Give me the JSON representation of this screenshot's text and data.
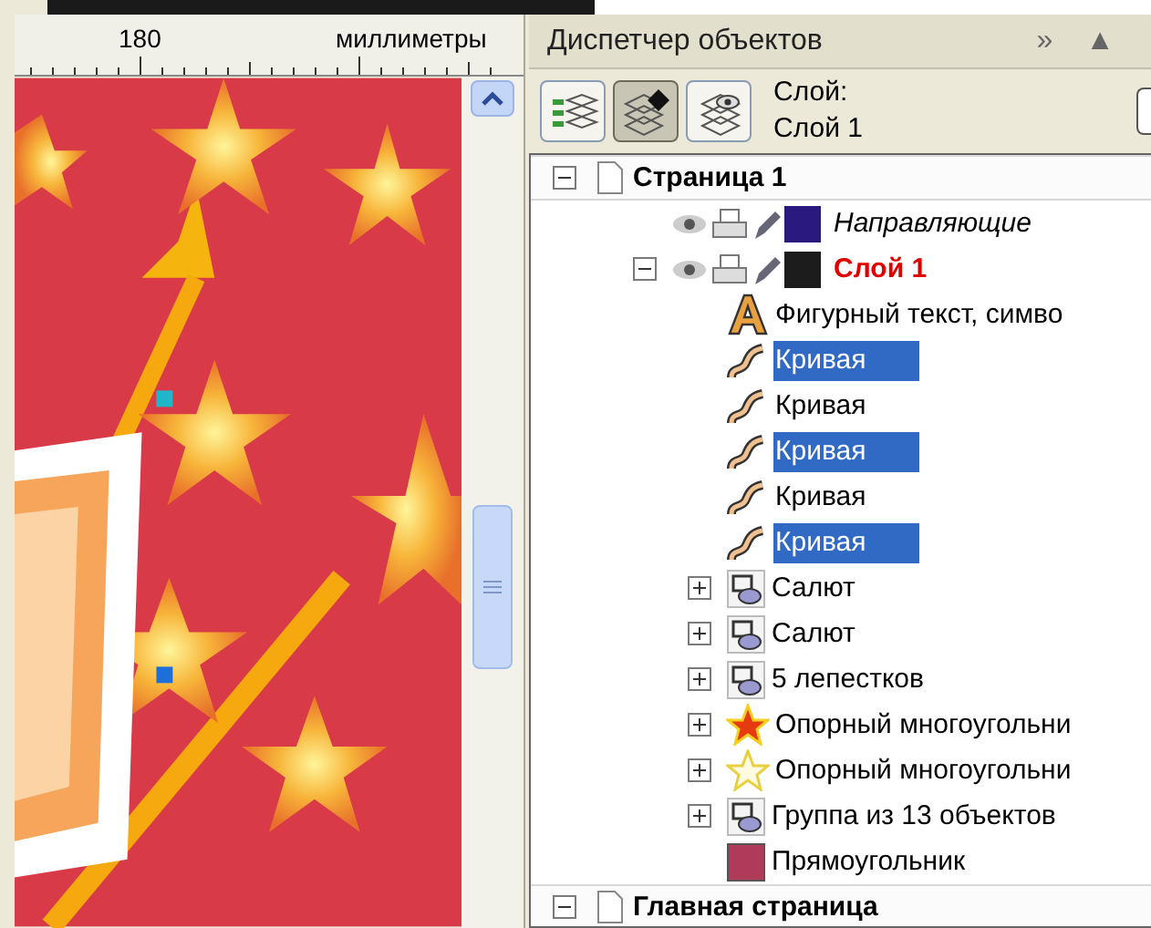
{
  "ruler": {
    "tick_label": "180",
    "units": "миллиметры"
  },
  "panel": {
    "title": "Диспетчер объектов",
    "header_buttons": [
      "»",
      "▲"
    ],
    "toolbar": [
      {
        "kind": "layers-list",
        "selected": false
      },
      {
        "kind": "edit-across-layers",
        "selected": true
      },
      {
        "kind": "layer-view",
        "selected": false
      }
    ],
    "layer_caption": "Слой:",
    "layer_name": "Слой 1"
  },
  "tree": [
    {
      "kind": "page",
      "label": "Страница 1",
      "expanded": true,
      "children": [
        {
          "kind": "layer",
          "label": "Направляющие",
          "color": "#2a1a80",
          "italic": true
        },
        {
          "kind": "layer",
          "label": "Слой 1",
          "color": "#1c1c1c",
          "active": true,
          "expanded": true,
          "children": [
            {
              "kind": "text",
              "label": "Фигурный текст, симво",
              "selected": false
            },
            {
              "kind": "curve",
              "label": "Кривая",
              "selected": true
            },
            {
              "kind": "curve",
              "label": "Кривая",
              "selected": false
            },
            {
              "kind": "curve",
              "label": "Кривая",
              "selected": true
            },
            {
              "kind": "curve",
              "label": "Кривая",
              "selected": false
            },
            {
              "kind": "curve",
              "label": "Кривая",
              "selected": true
            },
            {
              "kind": "group",
              "label": "Салют",
              "selected": false,
              "expanded": false
            },
            {
              "kind": "group",
              "label": "Салют",
              "selected": false,
              "expanded": false
            },
            {
              "kind": "group",
              "label": "5 лепестков",
              "selected": false,
              "expanded": false
            },
            {
              "kind": "star-filled",
              "label": "Опорный многоугольни",
              "selected": false,
              "expanded": false
            },
            {
              "kind": "star-outline",
              "label": "Опорный многоугольни",
              "selected": false,
              "expanded": false
            },
            {
              "kind": "group",
              "label": "Группа из 13 объектов",
              "selected": false,
              "expanded": false
            },
            {
              "kind": "rectangle",
              "label": "Прямоугольник",
              "selected": false
            }
          ]
        }
      ]
    },
    {
      "kind": "page",
      "label": "Главная страница",
      "expanded": true
    }
  ]
}
